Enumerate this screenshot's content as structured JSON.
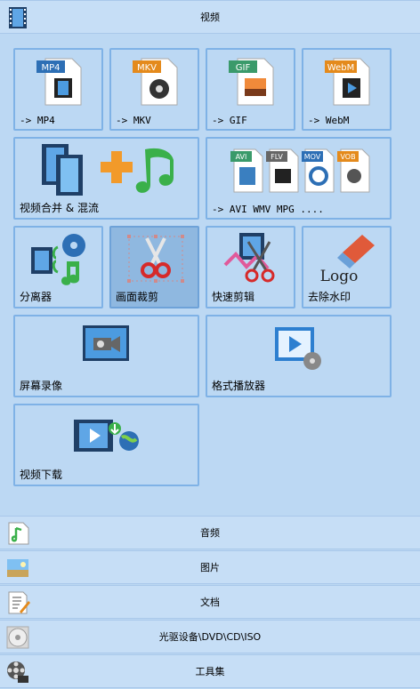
{
  "video_section": {
    "title": "视频",
    "tiles": [
      {
        "label": "-> MP4",
        "badge": "MP4"
      },
      {
        "label": "-> MKV",
        "badge": "MKV"
      },
      {
        "label": "-> GIF",
        "badge": "GIF"
      },
      {
        "label": "-> WebM",
        "badge": "WebM"
      },
      {
        "label": "视频合并 & 混流"
      },
      {
        "label": "-> AVI WMV MPG ....",
        "badges": [
          "AVI",
          "FLV",
          "MOV",
          "VOB"
        ]
      },
      {
        "label": "分离器"
      },
      {
        "label": "画面裁剪",
        "selected": true
      },
      {
        "label": "快速剪辑"
      },
      {
        "label": "去除水印",
        "badge": "Logo"
      },
      {
        "label": "屏幕录像"
      },
      {
        "label": "格式播放器"
      },
      {
        "label": "视频下载"
      }
    ]
  },
  "bottom_sections": [
    {
      "title": "音频",
      "icon": "music-file-icon"
    },
    {
      "title": "图片",
      "icon": "picture-icon"
    },
    {
      "title": "文档",
      "icon": "document-icon"
    },
    {
      "title": "光驱设备\\DVD\\CD\\ISO",
      "icon": "disc-icon"
    },
    {
      "title": "工具集",
      "icon": "film-reel-icon"
    }
  ],
  "colors": {
    "background": "#bcd8f3",
    "tile_border": "#7fb2e6",
    "selected_tile": "#8fb8e0",
    "header_bg": "#c6def6"
  }
}
